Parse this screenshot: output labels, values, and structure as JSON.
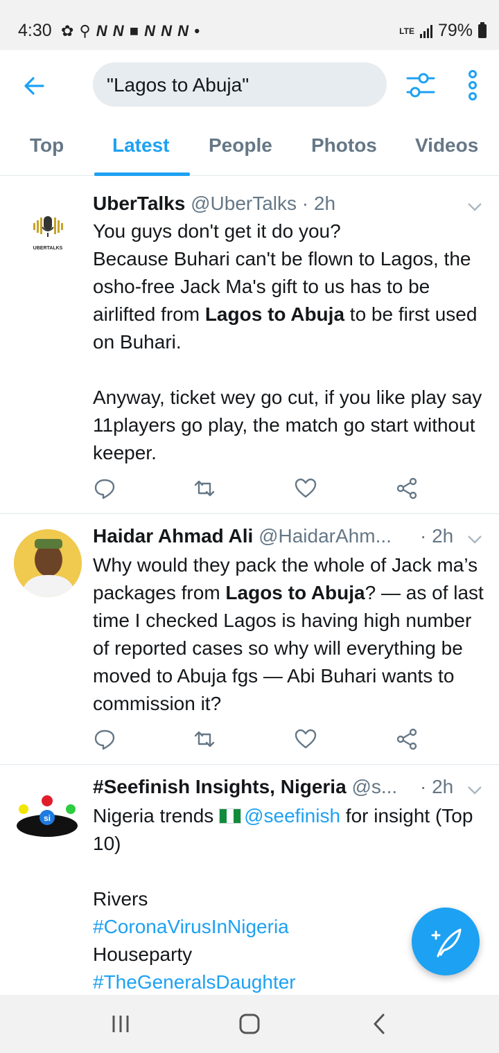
{
  "status_bar": {
    "time": "4:30",
    "notification_icons": "✿ ⚲ N N ■ N N N •",
    "network": "LTE",
    "battery": "79%"
  },
  "search": {
    "query": "\"Lagos to Abuja\""
  },
  "tabs": [
    {
      "label": "Top",
      "active": false
    },
    {
      "label": "Latest",
      "active": true
    },
    {
      "label": "People",
      "active": false
    },
    {
      "label": "Photos",
      "active": false
    },
    {
      "label": "Videos",
      "active": false
    }
  ],
  "tweets": [
    {
      "name": "UberTalks",
      "handle": "@UberTalks",
      "time": "· 2h",
      "avatar_label": "UBERTALKS",
      "body_1": "You guys don't get it do you?\nBecause Buhari can't be flown to Lagos, the osho-free Jack Ma's gift to us has to be airlifted from ",
      "highlight": "Lagos to Abuja",
      "body_2": " to be first used on Buhari.\n\nAnyway, ticket wey go cut, if you like play say 11players go play, the match go start without keeper."
    },
    {
      "name": "Haidar Ahmad Ali",
      "handle": "@HaidarAhm...",
      "time": "· 2h",
      "body_1": "Why would they pack the whole of Jack ma’s packages from ",
      "highlight": "Lagos to Abuja",
      "body_2": "? — as of last time I checked Lagos is having high number of reported cases so why will everything be moved to Abuja fgs — Abi Buhari wants to commission it?"
    },
    {
      "name": "#Seefinish Insights, Nigeria",
      "handle": "@s...",
      "time": "· 2h",
      "avatar_label": "si",
      "body_1": "Nigeria trends ",
      "mention": "@seefinish",
      "body_2": " for insight (Top 10)\n\nRivers",
      "hashtag_1": "#CoronaVirusInNigeria",
      "line_3": "Houseparty",
      "hashtag_2": "#TheGeneralsDaughter"
    }
  ],
  "colors": {
    "accent": "#1da1f2",
    "text": "#14171a",
    "muted": "#657786"
  }
}
